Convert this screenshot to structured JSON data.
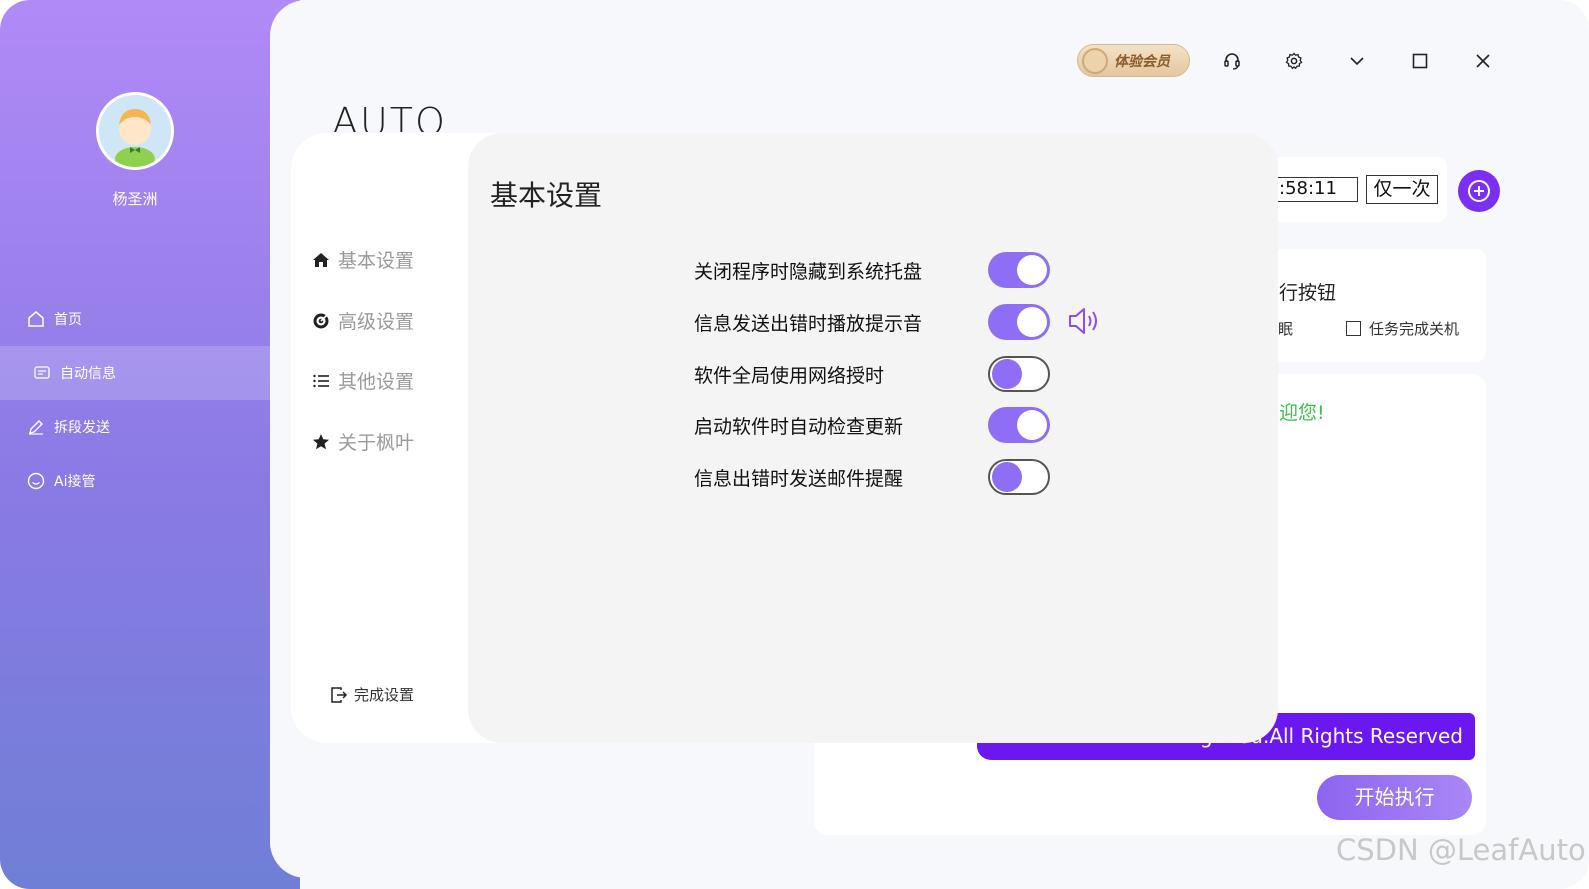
{
  "user": {
    "name": "杨圣洲"
  },
  "nav": [
    {
      "label": "首页",
      "icon": "home-icon"
    },
    {
      "label": "自动信息",
      "icon": "message-icon",
      "active": true
    },
    {
      "label": "拆段发送",
      "icon": "edit-icon"
    },
    {
      "label": "Ai接管",
      "icon": "smile-icon"
    }
  ],
  "topbar": {
    "vip_label": "体验会员"
  },
  "brand": {
    "text": "AUTO"
  },
  "schedule": {
    "time_fragment": ":58:11",
    "repeat_label": "仅一次"
  },
  "exec": {
    "title_fragment": "行按钮",
    "sleep_fragment": "眠",
    "shutdown_label": "任务完成关机"
  },
  "log": {
    "welcome_fragment": "迎您!",
    "rights_fragment": "g  ...ou.All Rights Reserved"
  },
  "start_button": "开始执行",
  "settings": {
    "title": "基本设置",
    "menu": [
      {
        "label": "基本设置",
        "icon": "home-icon"
      },
      {
        "label": "高级设置",
        "icon": "target-icon"
      },
      {
        "label": "其他设置",
        "icon": "list-icon"
      },
      {
        "label": "关于枫叶",
        "icon": "star-icon"
      }
    ],
    "finish_label": "完成设置",
    "options": [
      {
        "label": "关闭程序时隐藏到系统托盘",
        "enabled": true
      },
      {
        "label": "信息发送出错时播放提示音",
        "enabled": true
      },
      {
        "label": "软件全局使用网络授时",
        "enabled": false
      },
      {
        "label": "启动软件时自动检查更新",
        "enabled": true
      },
      {
        "label": "信息出错时发送邮件提醒",
        "enabled": false
      }
    ]
  },
  "colors": {
    "accent": "#8d6ef5",
    "brand_purple": "#7b2ff2",
    "welcome_green": "#3bbf4d"
  },
  "watermark": "CSDN @LeafAuto"
}
